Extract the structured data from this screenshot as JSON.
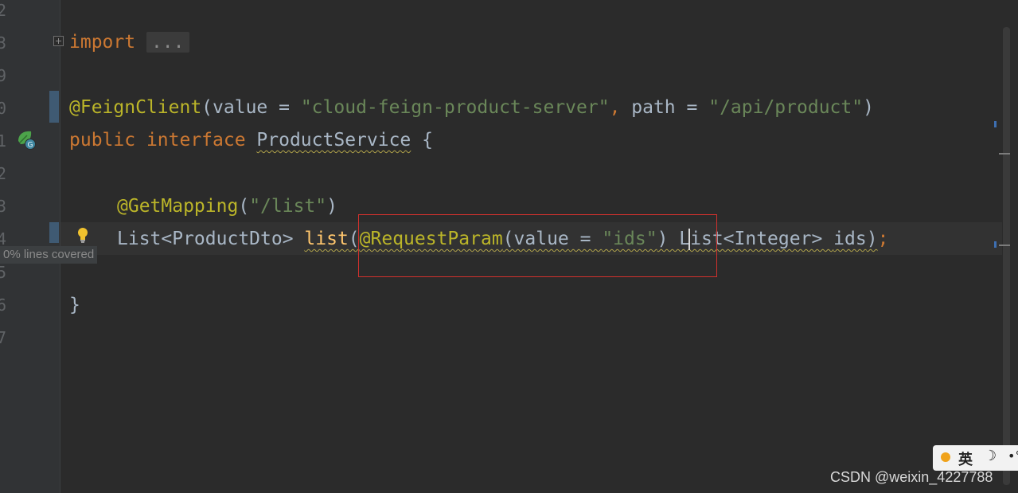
{
  "gutter": {
    "line_numbers": [
      "2",
      "3",
      "9",
      "0",
      "1",
      "2",
      "3",
      "4",
      "5",
      "6",
      "7"
    ],
    "coverage_tooltip": "0% lines covered"
  },
  "code": {
    "import_kw": "import",
    "import_fold": "...",
    "feign_annotation": "@FeignClient",
    "feign_open": "(",
    "feign_value_param": "value",
    "feign_eq1": " = ",
    "feign_value_str": "\"cloud-feign-product-server\"",
    "feign_comma": ",",
    "feign_path_param": " path",
    "feign_eq2": " = ",
    "feign_path_str": "\"/api/product\"",
    "feign_close": ")",
    "public_kw": "public",
    "interface_kw": " interface ",
    "interface_name": "ProductService",
    "open_brace": " {",
    "get_mapping_annotation": "@GetMapping",
    "get_mapping_open": "(",
    "get_mapping_str": "\"/list\"",
    "get_mapping_close": ")",
    "return_type": "List<ProductDto> ",
    "method_name": "list",
    "method_open": "(",
    "request_param_annotation": "@RequestParam",
    "request_param_open": "(",
    "request_param_value": "value",
    "request_param_eq": " = ",
    "request_param_str": "\"ids\"",
    "request_param_close": ")",
    "param_type": " List<Integer> ",
    "param_name": "ids",
    "method_close": ")",
    "semicolon": ";",
    "close_brace": "}"
  },
  "ime": {
    "language": "英",
    "moon": "☽",
    "more": "•°"
  },
  "watermark": "CSDN @weixin_4227788",
  "colors": {
    "background": "#2b2b2b",
    "keyword": "#cc7832",
    "annotation": "#bbb529",
    "string": "#6a8759",
    "text": "#a9b7c6",
    "highlight_box": "#d1312d"
  }
}
